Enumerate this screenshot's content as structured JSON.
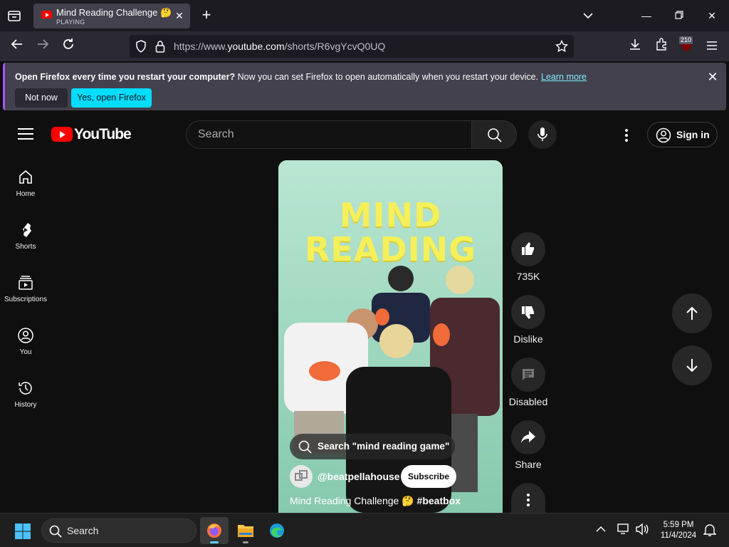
{
  "browser": {
    "tab": {
      "title": "Mind Reading Challenge 🤔 #beatbox",
      "status": "PLAYING"
    },
    "url": {
      "prefix": "https://www.",
      "host": "youtube.com",
      "path": "/shorts/R6vgYcvQ0UQ"
    },
    "extension_badge": "210"
  },
  "notification": {
    "bold": "Open Firefox every time you restart your computer?",
    "text": " Now you can set Firefox to open automatically when you restart your device.",
    "link": "Learn more",
    "btn_not_now": "Not now",
    "btn_yes": "Yes, open Firefox"
  },
  "youtube": {
    "logo_text": "YouTube",
    "search_placeholder": "Search",
    "sign_in": "Sign in",
    "guide": [
      {
        "label": "Home"
      },
      {
        "label": "Shorts"
      },
      {
        "label": "Subscriptions"
      },
      {
        "label": "You"
      },
      {
        "label": "History"
      }
    ],
    "short": {
      "overlay_line1": "MIND",
      "overlay_line2": "READING",
      "suggestion": "Search \"mind reading game\"",
      "channel": "@beatpellahouse",
      "subscribe": "Subscribe",
      "title_text": "Mind Reading Challenge 🤔 ",
      "title_tag": "#beatbox"
    },
    "actions": {
      "likes": "735K",
      "dislike": "Dislike",
      "comments": "Disabled",
      "share": "Share"
    }
  },
  "taskbar": {
    "search": "Search",
    "time": "5:59 PM",
    "date": "11/4/2024"
  },
  "colors": {
    "yt_red": "#ff0000",
    "firefox_accent": "#00ddff",
    "title_yellow": "#f5f05a"
  }
}
